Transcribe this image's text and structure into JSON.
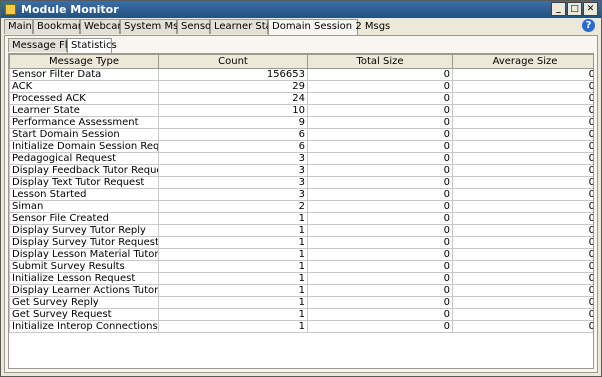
{
  "window": {
    "title": "Module Monitor",
    "controls": [
      "_",
      "□",
      "✕"
    ]
  },
  "tabs": [
    {
      "label": "Main"
    },
    {
      "label": "Bookmarks"
    },
    {
      "label": "Webcams"
    },
    {
      "label": "System Msgs"
    },
    {
      "label": "Sensor"
    },
    {
      "label": "Learner State"
    },
    {
      "label": "Domain Session 2 Msgs"
    }
  ],
  "active_tab": "Domain Session 2 Msgs",
  "help_label": "?",
  "subtabs": [
    {
      "label": "Message Flow"
    },
    {
      "label": "Statistics"
    }
  ],
  "active_subtab": "Statistics",
  "table": {
    "columns": [
      "Message Type",
      "Count",
      "Total Size",
      "Average Size"
    ],
    "rows": [
      [
        "Sensor Filter Data",
        "156653",
        "0",
        "0"
      ],
      [
        "ACK",
        "29",
        "0",
        "0"
      ],
      [
        "Processed ACK",
        "24",
        "0",
        "0"
      ],
      [
        "Learner State",
        "10",
        "0",
        "0"
      ],
      [
        "Performance Assessment",
        "9",
        "0",
        "0"
      ],
      [
        "Start Domain Session",
        "6",
        "0",
        "0"
      ],
      [
        "Initialize Domain Session Request",
        "6",
        "0",
        "0"
      ],
      [
        "Pedagogical Request",
        "3",
        "0",
        "0"
      ],
      [
        "Display Feedback Tutor Request",
        "3",
        "0",
        "0"
      ],
      [
        "Display Text Tutor Request",
        "3",
        "0",
        "0"
      ],
      [
        "Lesson Started",
        "3",
        "0",
        "0"
      ],
      [
        "Siman",
        "2",
        "0",
        "0"
      ],
      [
        "Sensor File Created",
        "1",
        "0",
        "0"
      ],
      [
        "Display Survey Tutor Reply",
        "1",
        "0",
        "0"
      ],
      [
        "Display Survey Tutor Request",
        "1",
        "0",
        "0"
      ],
      [
        "Display Lesson Material Tutor Request",
        "1",
        "0",
        "0"
      ],
      [
        "Submit Survey Results",
        "1",
        "0",
        "0"
      ],
      [
        "Initialize Lesson Request",
        "1",
        "0",
        "0"
      ],
      [
        "Display Learner Actions Tutor Request",
        "1",
        "0",
        "0"
      ],
      [
        "Get Survey Reply",
        "1",
        "0",
        "0"
      ],
      [
        "Get Survey Request",
        "1",
        "0",
        "0"
      ],
      [
        "Initialize Interop Connections",
        "1",
        "0",
        "0"
      ]
    ]
  }
}
